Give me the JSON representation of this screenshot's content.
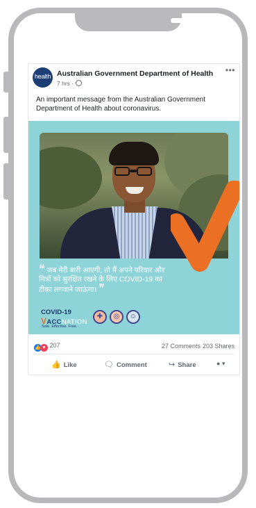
{
  "post": {
    "page_name": "Australian Government Department of Health",
    "avatar_text": "health",
    "time": "7 hrs ·",
    "more_icon": "more-dots-icon",
    "text": "An important message from the Australian Government Department of Health about coronavirus.",
    "image": {
      "quote_open": "❝",
      "quote_text": "जब मेरी बारी आएगी, तो मैं अपने परिवार और मित्रों को सुरक्षित रखने के लिए COVID-19 का टीका लगवाने जाऊंगा।",
      "quote_close": "❞",
      "logo_line1": "COVID-19",
      "logo_v": "V",
      "logo_acc": "ACC",
      "logo_nation": "NATION",
      "logo_tagline": "Safe. Effective. Free."
    },
    "reactions_count": "207",
    "comments": "27 Comments",
    "shares": "203 Shares",
    "actions": {
      "like": "Like",
      "comment": "Comment",
      "share": "Share"
    },
    "colors": {
      "teal_background": "#8ed3d8",
      "orange_tick": "#ec7024",
      "brand_blue": "#1a3a6e",
      "facebook_blue": "#1877f2"
    }
  }
}
